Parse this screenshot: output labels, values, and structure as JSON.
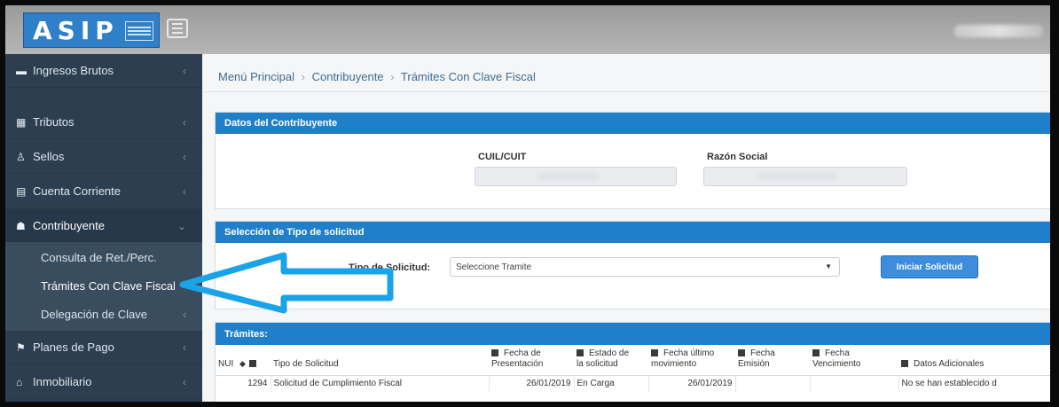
{
  "header": {
    "logo_text": "ASIP",
    "menu_toggle": "menu"
  },
  "sidebar": {
    "items": [
      {
        "icon": "▬",
        "label": "Ingresos Brutos"
      },
      {
        "icon": "▦",
        "label": "Tributos"
      },
      {
        "icon": "♙",
        "label": "Sellos"
      },
      {
        "icon": "▤",
        "label": "Cuenta Corriente"
      },
      {
        "icon": "☗",
        "label": "Contribuyente"
      },
      {
        "icon": "⚑",
        "label": "Planes de Pago"
      },
      {
        "icon": "⌂",
        "label": "Inmobiliario"
      }
    ],
    "sub_items": [
      {
        "label": "Consulta de Ret./Perc."
      },
      {
        "label": "Trámites Con Clave Fiscal"
      },
      {
        "label": "Delegación de Clave"
      }
    ],
    "chevron_left": "‹",
    "chevron_down": "⌄"
  },
  "breadcrumb": {
    "items": [
      "Menú Principal",
      "Contribuyente",
      "Trámites Con Clave Fiscal"
    ],
    "separator": "›"
  },
  "datos_panel": {
    "title": "Datos del Contribuyente",
    "cuit_label": "CUIL/CUIT",
    "razon_label": "Razón Social"
  },
  "seleccion_panel": {
    "title": "Selección de Tipo de solicitud",
    "field_label": "Tipo de Solicitud:",
    "select_value": "Seleccione Tramite",
    "button_label": "Iniciar Solicitud"
  },
  "tramites_panel": {
    "title": "Trámites:",
    "columns": [
      {
        "line1": "NUI",
        "line2": ""
      },
      {
        "line1": "",
        "line2": "Tipo de Solicitud"
      },
      {
        "line1": "Fecha de",
        "line2": "Presentación"
      },
      {
        "line1": "Estado de",
        "line2": "la solicitud"
      },
      {
        "line1": "Fecha último",
        "line2": "movimiento"
      },
      {
        "line1": "Fecha",
        "line2": "Emisión"
      },
      {
        "line1": "Fecha",
        "line2": "Vencimiento"
      },
      {
        "line1": "",
        "line2": "Datos Adicionales"
      }
    ],
    "rows": [
      {
        "nui": "1294",
        "tipo": "Solicitud de Cumplimiento Fiscal",
        "fecha_presentacion": "26/01/2019",
        "estado": "En Carga",
        "fecha_ultimo": "26/01/2019",
        "fecha_emision": "",
        "fecha_vencimiento": "",
        "datos_adicionales": "No se han establecido d"
      }
    ]
  },
  "colors": {
    "topbar": "#a8a8a8",
    "sidebar": "#2c3e50",
    "panel_header": "#1f7fc9",
    "primary_button": "#3c8dde",
    "arrow": "#1aa3e8"
  }
}
